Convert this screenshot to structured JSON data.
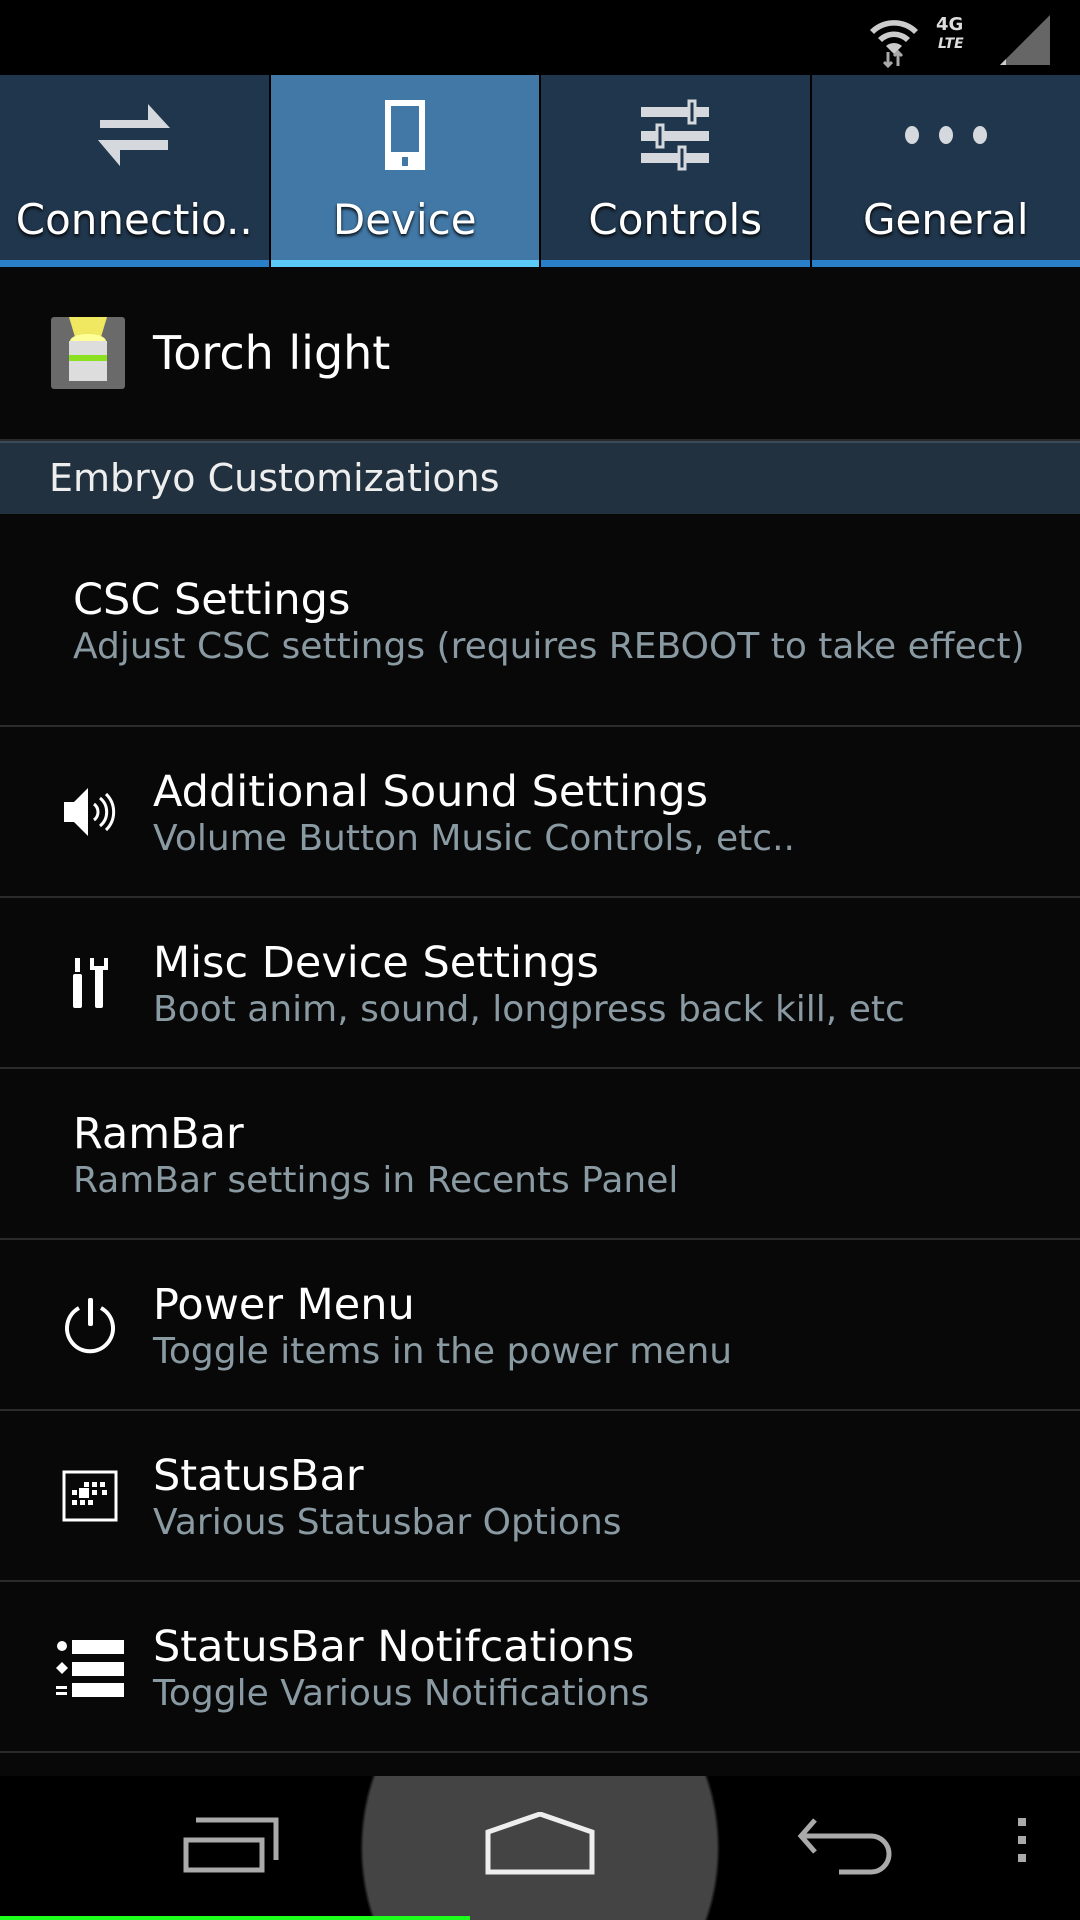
{
  "status_bar": {
    "network": "4G LTE",
    "icons": [
      "wifi-icon",
      "lte-icon",
      "signal-icon"
    ]
  },
  "tabs": [
    {
      "label": "Connectio..",
      "icon": "swap-arrows-icon"
    },
    {
      "label": "Device",
      "icon": "phone-icon",
      "active": true
    },
    {
      "label": "Controls",
      "icon": "sliders-icon"
    },
    {
      "label": "General",
      "icon": "more-dots-icon"
    }
  ],
  "torch": {
    "label": "Torch light"
  },
  "section_header": "Embryo Customizations",
  "items": [
    {
      "title": "CSC Settings",
      "subtitle": "Adjust CSC settings (requires REBOOT to take effect)"
    },
    {
      "title": "Additional Sound Settings",
      "subtitle": "Volume Button Music Controls, etc..",
      "icon": "speaker-icon"
    },
    {
      "title": "Misc Device Settings",
      "subtitle": "Boot anim, sound, longpress back kill, etc",
      "icon": "tools-icon"
    },
    {
      "title": "RamBar",
      "subtitle": "RamBar settings in Recents Panel"
    },
    {
      "title": "Power Menu",
      "subtitle": "Toggle items in the power menu",
      "icon": "power-icon"
    },
    {
      "title": "StatusBar",
      "subtitle": "Various Statusbar Options",
      "icon": "statusbar-grid-icon"
    },
    {
      "title": "StatusBar Notifcations",
      "subtitle": "Toggle Various Notifications",
      "icon": "list-icon"
    }
  ],
  "colors": {
    "tab_bg": "#20364c",
    "tab_active": "#4278a6",
    "accent": "#5ccaf7",
    "subtitle": "#8a9aa2"
  }
}
